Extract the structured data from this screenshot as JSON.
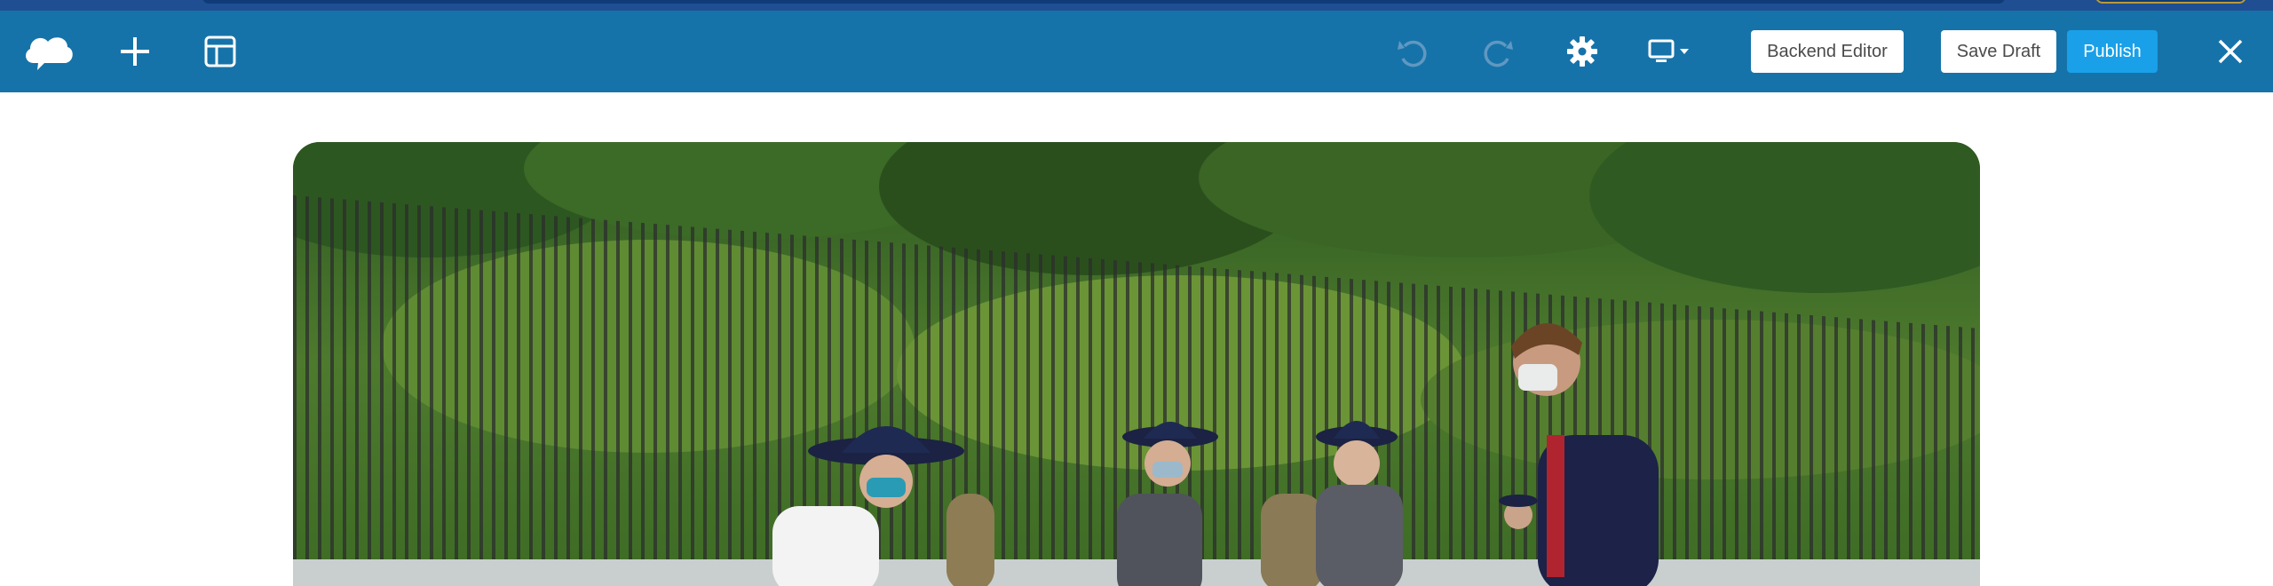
{
  "toolbar": {
    "backend_editor_label": "Backend Editor",
    "save_draft_label": "Save Draft",
    "publish_label": "Publish",
    "icons": [
      "cloud-logo-icon",
      "plus-icon",
      "layout-icon",
      "undo-icon",
      "redo-icon",
      "gear-icon",
      "desktop-icon",
      "chevron-down-icon",
      "close-icon"
    ]
  },
  "colors": {
    "toolbar_bg": "#1673a9",
    "publish_bg": "#19a0e8",
    "icon_white": "#ffffff",
    "icon_disabled": "#5f98c2"
  },
  "hero": {
    "image_type": "photo"
  }
}
